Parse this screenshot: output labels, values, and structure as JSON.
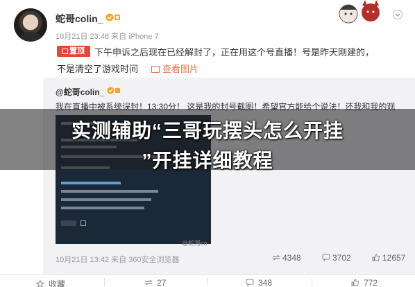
{
  "post": {
    "username": "蛇哥colin_",
    "meta": "10月21日 23:48 来自 iPhone 7",
    "pinned_label": "置顶",
    "body_line1": "下午申诉之后现在已经解封了，正在用这个号直播！号是昨天刚建的，",
    "body_line2": "不是清空了游戏时间",
    "view_image_label": "查看图片"
  },
  "repost": {
    "username": "@蛇哥colin_",
    "text": "我在直播中被系统误封！13:30分！ 这是我的封号截图！希望官方能给个说法！还我和我的观",
    "watermark": "@蛇哥co",
    "time": "10月21日 13:42 来自 360安全浏览器",
    "reposts": "4348",
    "comments": "3702",
    "likes": "12657"
  },
  "footer": {
    "favorite_label": "收藏",
    "reposts": "27",
    "comments": "348",
    "likes": "772"
  },
  "overlay": {
    "title_line1": "实测辅助“三哥玩摆头怎么开挂",
    "title_line2": "”开挂详细教程"
  },
  "colors": {
    "accent": "#eb7350",
    "pinned": "#e8453c",
    "steam_bg": "#1b2838"
  },
  "icons": [
    "verified-icon",
    "chevron-down-icon",
    "image-icon",
    "repost-icon",
    "comment-icon",
    "like-icon",
    "star-icon"
  ]
}
